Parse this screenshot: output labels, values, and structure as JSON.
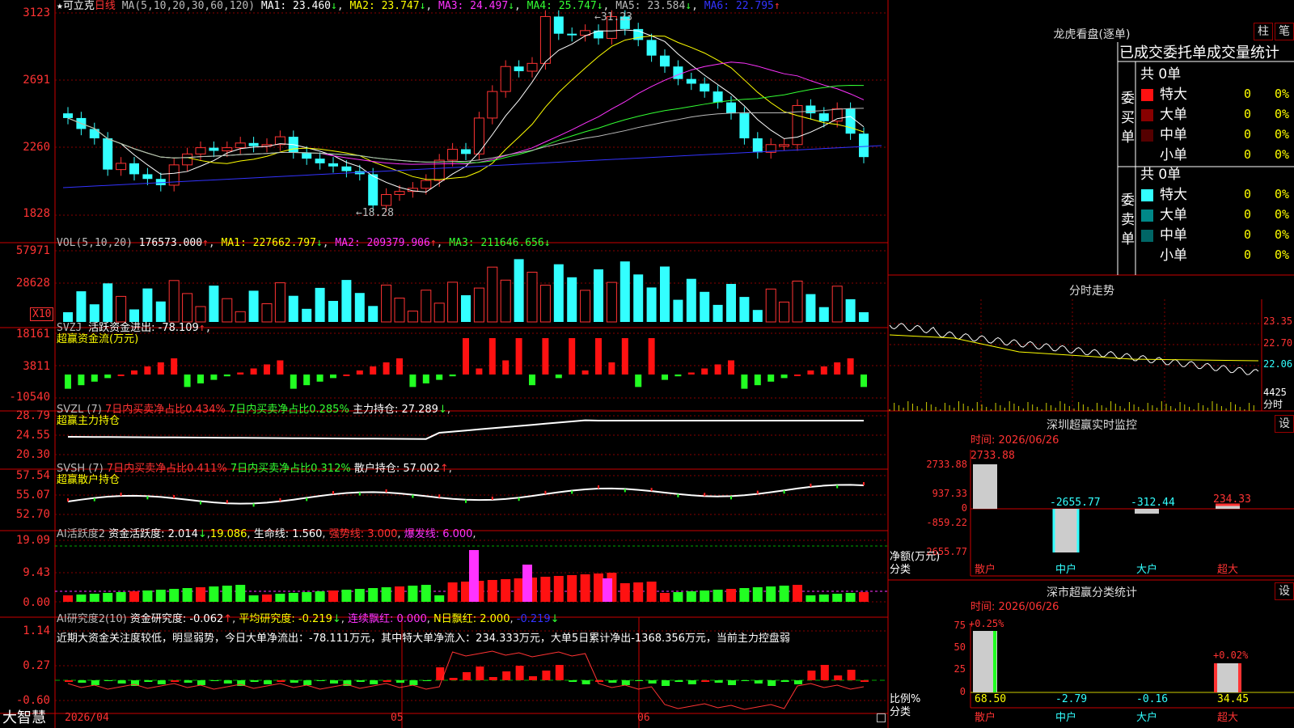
{
  "stock": {
    "name": "可立克",
    "period": "日线",
    "star": "★"
  },
  "main": {
    "ma_header": "MA(5,10,20,30,60,120)",
    "ma1": "MA1: 23.460",
    "ma2": "MA2: 23.747",
    "ma3": "MA3: 24.497",
    "ma4": "MA4: 25.747",
    "ma5": "MA5: 23.584",
    "ma6": "MA6: 22.795",
    "yticks": [
      "3123",
      "2691",
      "2260",
      "1828"
    ],
    "high_label": "31.23",
    "low_label": "18.28"
  },
  "vol": {
    "header": "VOL(5,10,20)",
    "value": "176573.000",
    "ma1": "MA1: 227662.797",
    "ma2": "MA2: 209379.906",
    "ma3": "MA3: 211646.656",
    "yticks": [
      "57971",
      "28628"
    ],
    "unit": "X10"
  },
  "svzj": {
    "header": "SVZJ",
    "label": "活跃资金进出: -78.109",
    "sub": "超赢资金流(万元)",
    "yticks": [
      "18161",
      "3811",
      "-10540"
    ]
  },
  "svzl": {
    "header": "SVZL (7)",
    "l1": "7日内买卖净占比0.434%",
    "l2": "7日内买卖净占比0.285%",
    "l3": "主力持仓: 27.289",
    "sub": "超赢主力持仓",
    "yticks": [
      "28.79",
      "24.55",
      "20.30"
    ]
  },
  "svsh": {
    "header": "SVSH (7)",
    "l1": "7日内买卖净占比0.411%",
    "l2": "7日内买卖净占比0.312%",
    "l3": "散户持仓: 57.002",
    "sub": "超赢散户持仓",
    "yticks": [
      "57.54",
      "55.07",
      "52.70"
    ]
  },
  "ai1": {
    "header": "AI活跃度2",
    "l1": "资金活跃度: 2.014",
    "l2": "19.086",
    "l3": "生命线: 1.560",
    "l4": "强势线: 3.000",
    "l5": "爆发线: 6.000",
    "yticks": [
      "19.09",
      "9.43",
      "0.00"
    ]
  },
  "ai2": {
    "header": "AI研究度2(10)",
    "l1": "资金研究度: -0.062",
    "l2": "平均研究度: -0.219",
    "l3": "连续飘红: 0.000",
    "l4": "N日飘红: 2.000",
    "l5": "-0.219",
    "yticks": [
      "1.14",
      "0.27",
      "-0.60"
    ],
    "comment": "近期大资金关注度较低，明显弱势，今日大单净流出：-78.111万元，其中特大单净流入：234.333万元，大单5日累计净出-1368.356万元，当前主力控盘弱"
  },
  "bottom": {
    "brand": "大智慧",
    "dates": [
      "2026/04",
      "05",
      "06"
    ]
  },
  "right": {
    "lhb_title": "龙虎看盘(逐单)",
    "btn_zhu": "柱",
    "btn_bi": "笔",
    "lhb_header": "已成交委托单成交量统计",
    "buy_label": "委买单",
    "sell_label": "委卖单",
    "buy_total": "共 0单",
    "sell_total": "共 0单",
    "rows": [
      "特大",
      "大单",
      "中单",
      "小单"
    ],
    "row_val": "0",
    "row_pct": "0%",
    "fs_title": "分时走势",
    "fs_prices": [
      "23.35",
      "22.70",
      "22.06"
    ],
    "fs_vol": "4425",
    "fs_unit": "分时",
    "mon_title": "深圳超赢实时监控",
    "mon_btn": "设",
    "mon_time": "时间: 2026/06/26",
    "mon_yticks": [
      "2733.88",
      "937.33",
      "0",
      "-859.22",
      "-2655.77"
    ],
    "mon_bars": [
      {
        "cat": "散户",
        "val": "2733.88"
      },
      {
        "cat": "中户",
        "val": "-2655.77"
      },
      {
        "cat": "大户",
        "val": "-312.44"
      },
      {
        "cat": "超大",
        "val": "234.33"
      }
    ],
    "mon_unit1": "净额(万元)",
    "mon_unit2": "分类",
    "cls_title": "深市超赢分类统计",
    "cls_btn": "设",
    "cls_time": "时间: 2026/06/26",
    "cls_yticks": [
      "75",
      "50",
      "25",
      "0"
    ],
    "cls_top": [
      "+0.25%",
      "+0.02%"
    ],
    "cls_vals": [
      {
        "cat": "散户",
        "val": "68.50"
      },
      {
        "cat": "中户",
        "val": "-2.79"
      },
      {
        "cat": "大户",
        "val": "-0.16"
      },
      {
        "cat": "超大",
        "val": "34.45"
      }
    ],
    "cls_unit1": "比例%",
    "cls_unit2": "分类"
  },
  "chart_data": {
    "type": "bar",
    "title": "深圳超赢实时监控",
    "categories": [
      "散户",
      "中户",
      "大户",
      "超大"
    ],
    "values": [
      2733.88,
      -2655.77,
      -312.44,
      234.33
    ],
    "ylabel": "净额(万元)",
    "ylim": [
      -2655.77,
      2733.88
    ]
  }
}
